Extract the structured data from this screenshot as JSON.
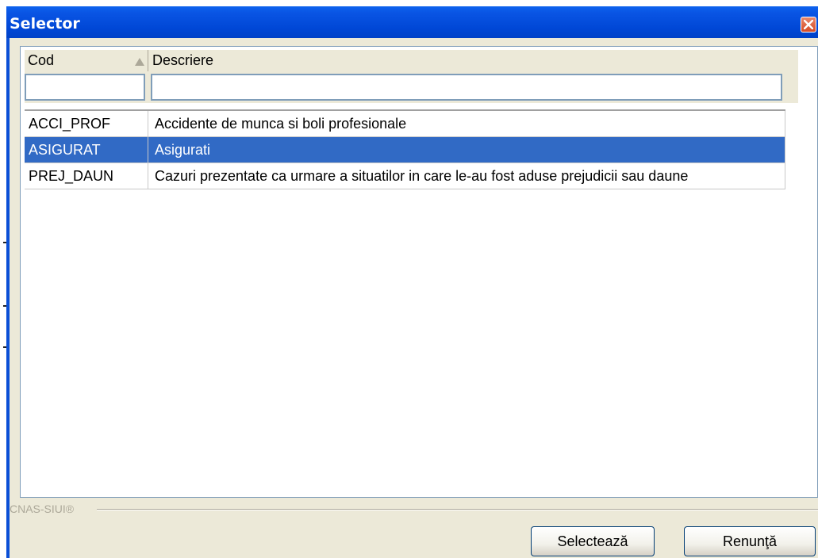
{
  "window": {
    "title": "Selector"
  },
  "grid": {
    "columns": [
      {
        "label": "Cod"
      },
      {
        "label": "Descriere"
      }
    ],
    "filters": {
      "cod_value": "",
      "desc_value": ""
    },
    "rows": [
      {
        "cod": "ACCI_PROF",
        "descriere": "Accidente de munca si boli profesionale"
      },
      {
        "cod": "ASIGURAT",
        "descriere": "Asigurati"
      },
      {
        "cod": "PREJ_DAUN",
        "descriere": "Cazuri prezentate ca urmare a situatilor in care le-au fost aduse prejudicii sau daune"
      }
    ],
    "selected_index": 1
  },
  "footer": {
    "brand": "CNAS-SIUI®"
  },
  "buttons": {
    "select_label": "Selectează",
    "cancel_label": "Renunţă"
  },
  "colors": {
    "title_bar": "#0047d6",
    "selection": "#316ac5",
    "dialog_bg": "#ece9d8"
  },
  "icons": {
    "close": "close-icon",
    "sort": "sort-ascending-icon"
  }
}
